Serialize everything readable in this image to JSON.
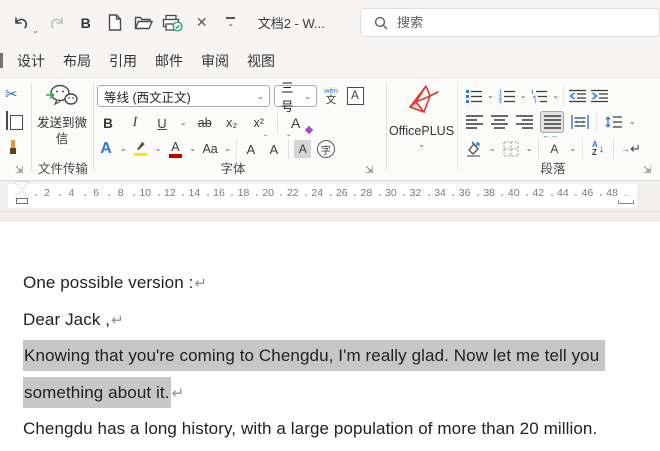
{
  "titlebar": {
    "title": "文档2  -  W...",
    "bold_glyph": "B",
    "close_glyph": "✕",
    "search_placeholder": "搜索"
  },
  "tabs": [
    "设计",
    "布局",
    "引用",
    "邮件",
    "审阅",
    "视图"
  ],
  "ribbon": {
    "wechat_button": "发送到微信",
    "group_labels": {
      "transfer": "文件传输",
      "font": "字体",
      "paragraph": "段落"
    },
    "font_name": "等线 (西文正文)",
    "font_size": "三号",
    "officeplus_label": "OfficePLUS",
    "glyphs": {
      "bold": "B",
      "italic": "I",
      "underline": "U",
      "strikethrough": "ab",
      "subscript": "x₂",
      "superscript": "x²",
      "clear_format": "A",
      "text_effects": "A",
      "font_color": "A",
      "change_case": "Aa",
      "grow_font": "A",
      "shrink_font": "A",
      "char_shading": "A",
      "enclose_char": "字",
      "char_border": "A",
      "pinyin_top": "wén",
      "pinyin_bottom": "文",
      "char_scale": "A",
      "sort_a": "A",
      "sort_z": "Z",
      "show_marks": "↵",
      "show_marks_arrow": "→",
      "dropdown": "⌄",
      "launcher": "⇲"
    }
  },
  "ruler": {
    "numbers": [
      2,
      4,
      6,
      8,
      10,
      12,
      14,
      16,
      18,
      20,
      22,
      24,
      26,
      28,
      30,
      32,
      34,
      36,
      38,
      40,
      42,
      44,
      46,
      48
    ]
  },
  "document": {
    "lines": [
      {
        "text": "One possible version :",
        "mark": "↵",
        "highlight": false
      },
      {
        "text": "Dear Jack ,",
        "mark": "↵",
        "highlight": false
      },
      {
        "text": "Knowing that you're coming to Chengdu, I'm really glad. Now let me tell you ",
        "mark": "",
        "highlight": true
      },
      {
        "text": "something about it.",
        "mark": "↵",
        "highlight": true
      },
      {
        "text": "Chengdu has a long history, with a large population of more than 20 million.",
        "mark": "",
        "highlight": false
      }
    ]
  },
  "colors": {
    "accent_blue": "#2E7BD6",
    "underline_red": "#C00000",
    "highlight_yellow": "#FFE600",
    "eraser_purple": "#A64ACF",
    "wechat_green": "#34A853",
    "check_green": "#21A366",
    "officeplus_red": "#E0392F",
    "selection_gray": "#C7C7C7",
    "tab_text": "#333333"
  }
}
